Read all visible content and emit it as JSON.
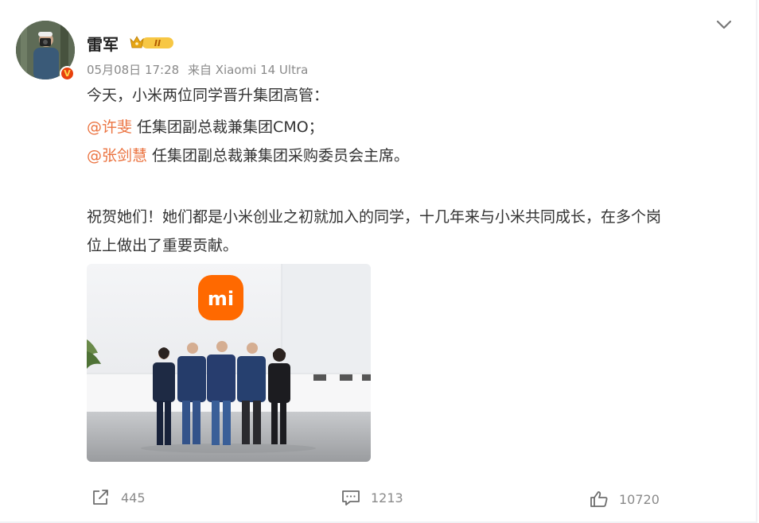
{
  "post": {
    "author": "雷军",
    "verified_badge": "V",
    "level_badge": "II",
    "date": "05月08日 17:28",
    "source": "来自 Xiaomi 14 Ultra",
    "line1": "今天，小米两位同学晋升集团高管：",
    "mention1": "@许斐",
    "line2": " 任集团副总裁兼集团CMO；",
    "mention2": "@张剑慧",
    "line3": " 任集团副总裁兼集团采购委员会主席。",
    "line4": "祝贺她们！她们都是小米创业之初就加入的同学，十几年来与小米共同成长，在多个岗",
    "line5": "位上做出了重要贡献。",
    "image_logo": "mi"
  },
  "actions": {
    "repost_count": "445",
    "comment_count": "1213",
    "like_count": "10720"
  },
  "icons": [
    "avatar",
    "vip-level-icon",
    "chevron-down-icon",
    "repost-icon",
    "comment-icon",
    "like-icon"
  ],
  "colors": {
    "mention": "#eb7340",
    "meta": "#8a8a8a",
    "xiaomi_orange": "#ff6900"
  }
}
